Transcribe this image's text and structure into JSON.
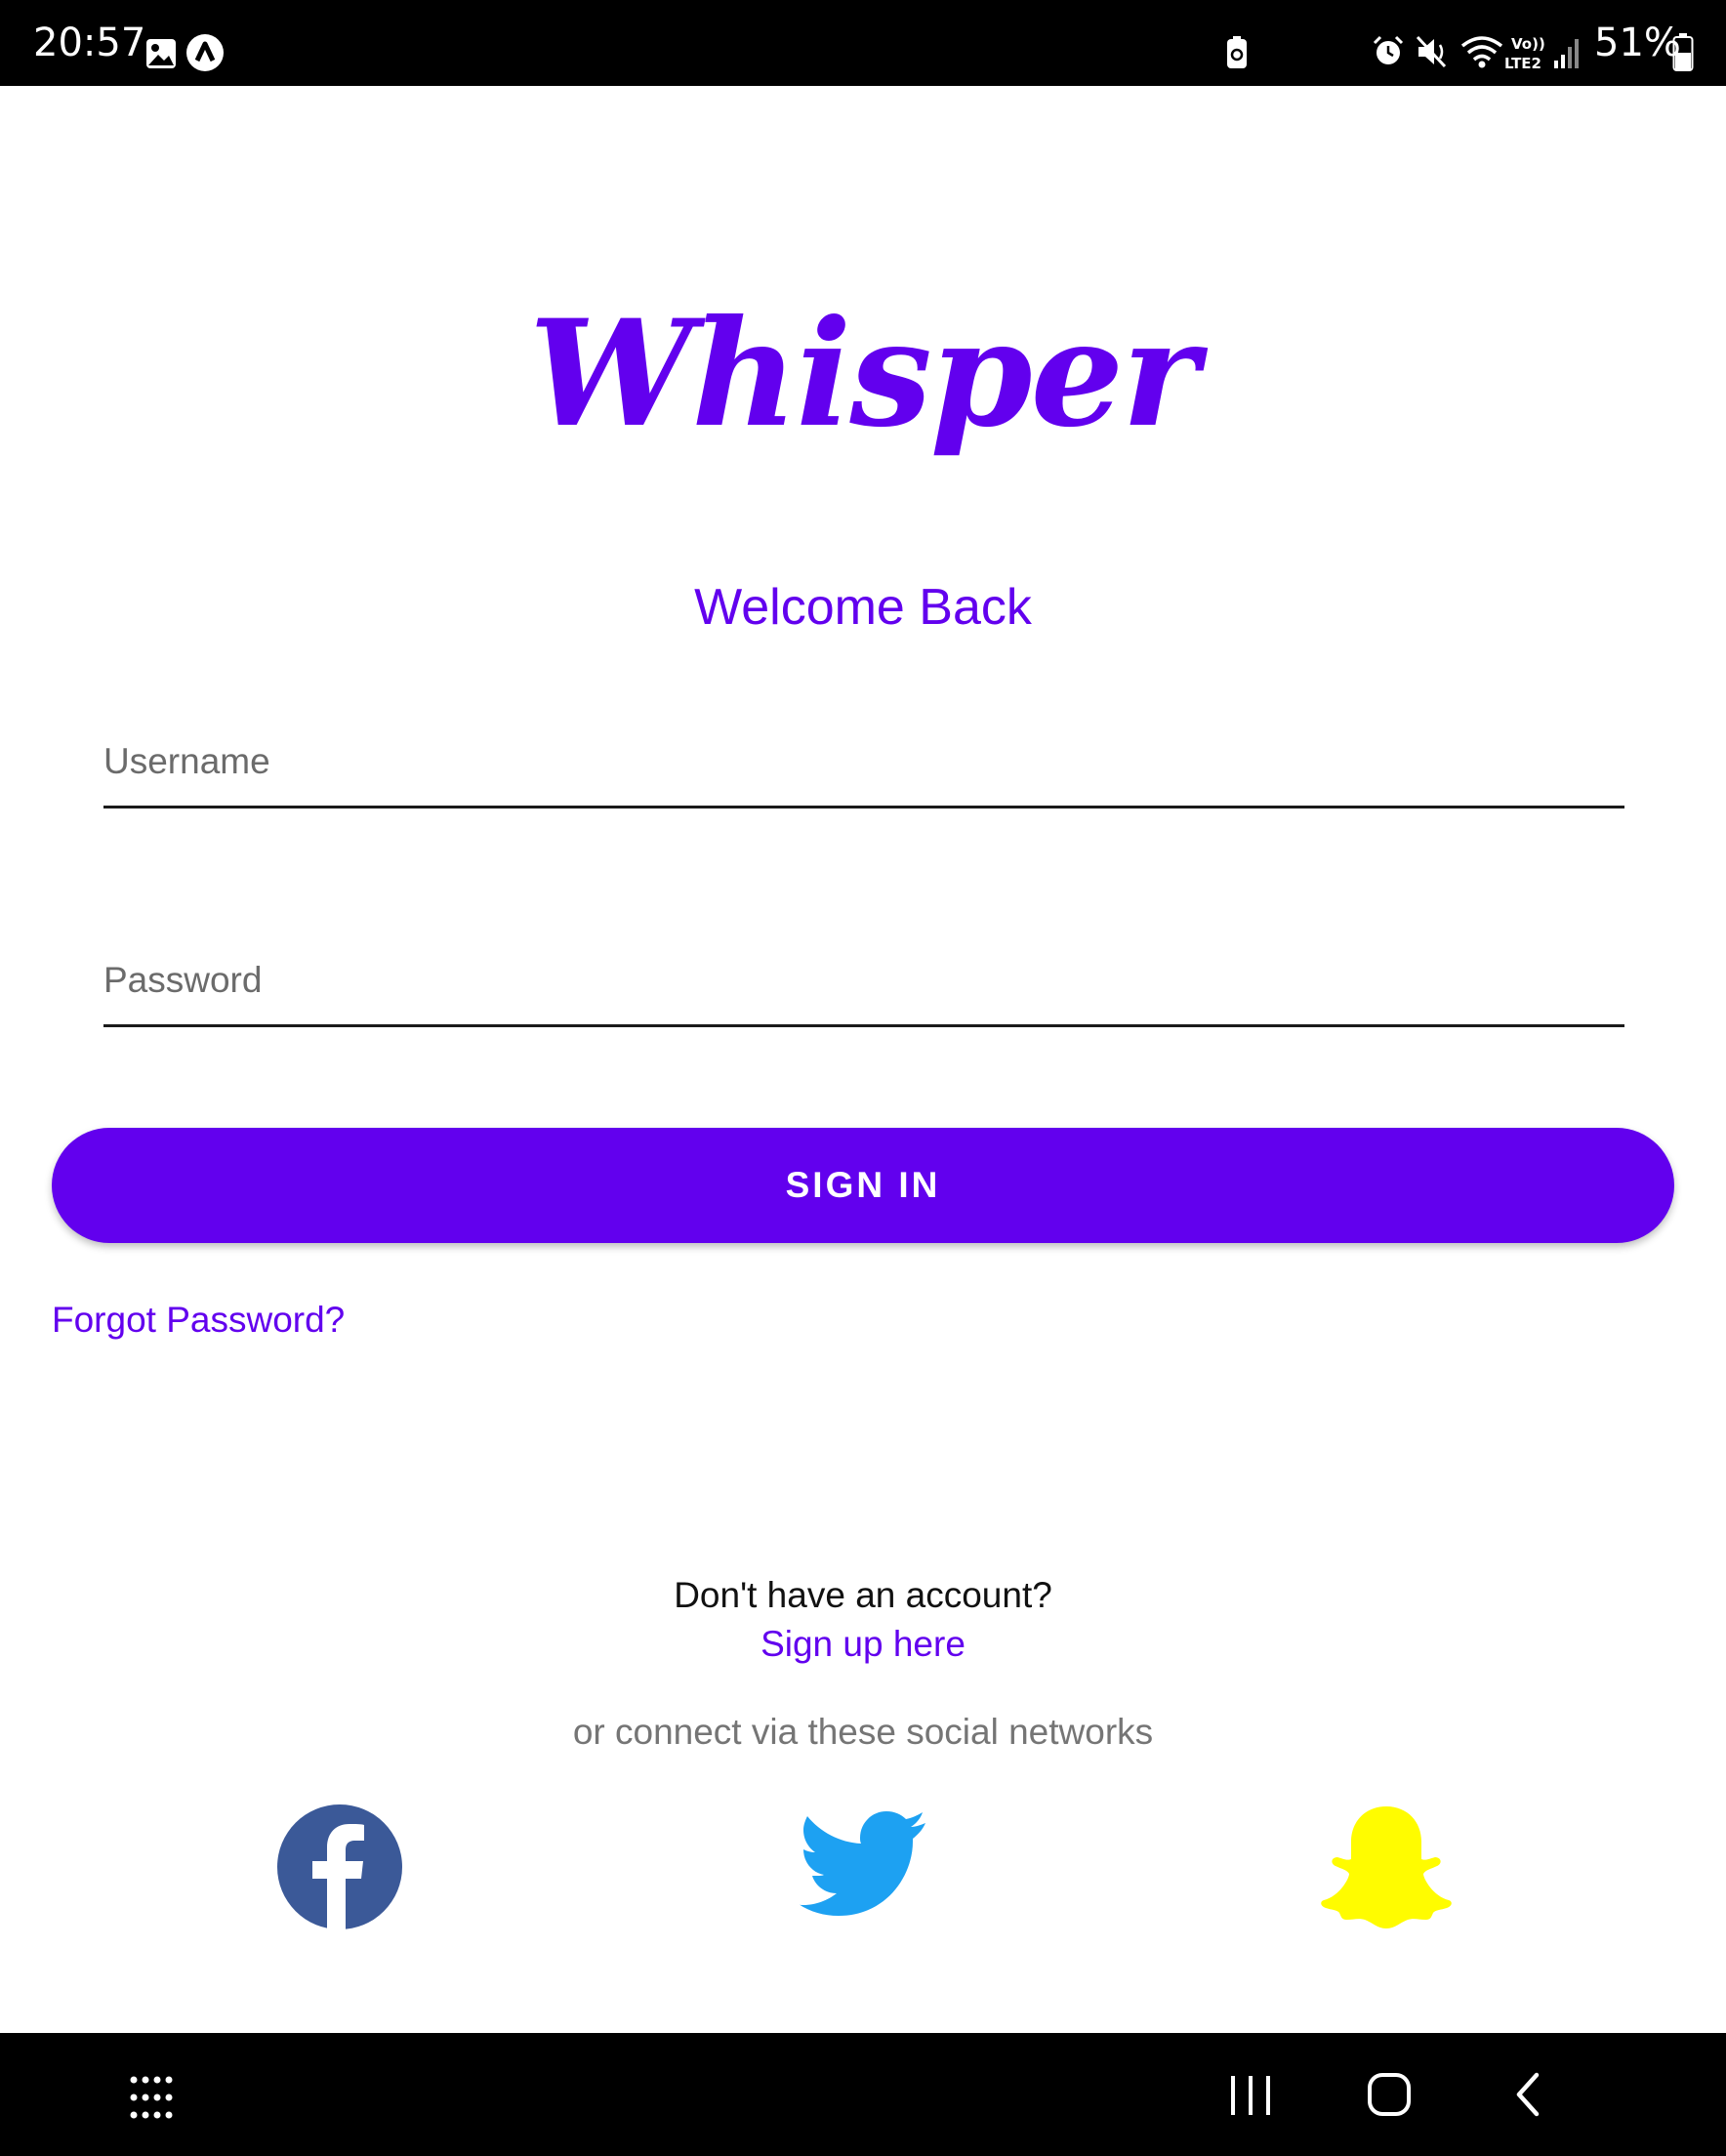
{
  "status_bar": {
    "time": "20:57",
    "battery_percent": "51%",
    "icons": [
      "gallery-icon",
      "app-icon",
      "battery-saver-icon",
      "alarm-icon",
      "mute-icon",
      "wifi-icon",
      "volte-icon",
      "signal-icon",
      "battery-icon"
    ],
    "volte_label": "Vo))",
    "lte_label": "LTE2"
  },
  "app": {
    "logo": "Whisper",
    "welcome": "Welcome Back",
    "accent_color": "#6200ee"
  },
  "form": {
    "username_placeholder": "Username",
    "username_value": "",
    "password_placeholder": "Password",
    "password_value": "",
    "sign_in_label": "SIGN IN",
    "forgot_password": "Forgot Password?"
  },
  "footer": {
    "no_account": "Don't have an account?",
    "sign_up": "Sign up here",
    "connect_text": "or connect via these social networks",
    "social": [
      {
        "name": "facebook-icon",
        "color": "#3b5998"
      },
      {
        "name": "twitter-icon",
        "color": "#1da1f2"
      },
      {
        "name": "snapchat-icon",
        "color": "#fffc00"
      }
    ]
  },
  "nav_bar": {
    "icons": [
      "app-drawer-icon",
      "recents-icon",
      "home-icon",
      "back-icon"
    ]
  }
}
